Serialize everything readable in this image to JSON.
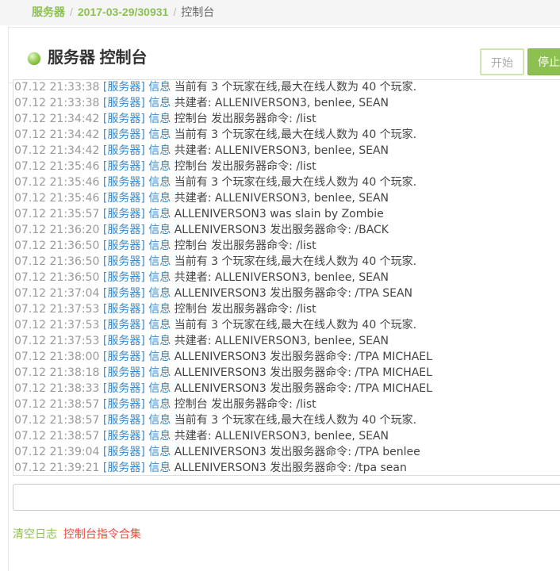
{
  "breadcrumb": {
    "items": [
      "服务器",
      "2017-03-29/30931"
    ],
    "current": "控制台",
    "separator": "/"
  },
  "header": {
    "title": "服务器 控制台",
    "status": "running",
    "start_label": "开始",
    "stop_label": "停止"
  },
  "console": {
    "lines": [
      {
        "ts": "07.12 21:33:38",
        "tag": "[服务器]",
        "level": "信息",
        "msg": "当前有 3 个玩家在线,最大在线人数为 40 个玩家."
      },
      {
        "ts": "07.12 21:33:38",
        "tag": "[服务器]",
        "level": "信息",
        "msg": "共建者: ALLENIVERSON3, benlee, SEAN"
      },
      {
        "ts": "07.12 21:34:42",
        "tag": "[服务器]",
        "level": "信息",
        "msg": "控制台 发出服务器命令: /list"
      },
      {
        "ts": "07.12 21:34:42",
        "tag": "[服务器]",
        "level": "信息",
        "msg": "当前有 3 个玩家在线,最大在线人数为 40 个玩家."
      },
      {
        "ts": "07.12 21:34:42",
        "tag": "[服务器]",
        "level": "信息",
        "msg": "共建者: ALLENIVERSON3, benlee, SEAN"
      },
      {
        "ts": "07.12 21:35:46",
        "tag": "[服务器]",
        "level": "信息",
        "msg": "控制台 发出服务器命令: /list"
      },
      {
        "ts": "07.12 21:35:46",
        "tag": "[服务器]",
        "level": "信息",
        "msg": "当前有 3 个玩家在线,最大在线人数为 40 个玩家."
      },
      {
        "ts": "07.12 21:35:46",
        "tag": "[服务器]",
        "level": "信息",
        "msg": "共建者: ALLENIVERSON3, benlee, SEAN"
      },
      {
        "ts": "07.12 21:35:57",
        "tag": "[服务器]",
        "level": "信息",
        "msg": "ALLENIVERSON3 was slain by Zombie"
      },
      {
        "ts": "07.12 21:36:20",
        "tag": "[服务器]",
        "level": "信息",
        "msg": "ALLENIVERSON3 发出服务器命令: /BACK"
      },
      {
        "ts": "07.12 21:36:50",
        "tag": "[服务器]",
        "level": "信息",
        "msg": "控制台 发出服务器命令: /list"
      },
      {
        "ts": "07.12 21:36:50",
        "tag": "[服务器]",
        "level": "信息",
        "msg": "当前有 3 个玩家在线,最大在线人数为 40 个玩家."
      },
      {
        "ts": "07.12 21:36:50",
        "tag": "[服务器]",
        "level": "信息",
        "msg": "共建者: ALLENIVERSON3, benlee, SEAN"
      },
      {
        "ts": "07.12 21:37:04",
        "tag": "[服务器]",
        "level": "信息",
        "msg": "ALLENIVERSON3 发出服务器命令: /TPA SEAN"
      },
      {
        "ts": "07.12 21:37:53",
        "tag": "[服务器]",
        "level": "信息",
        "msg": "控制台 发出服务器命令: /list"
      },
      {
        "ts": "07.12 21:37:53",
        "tag": "[服务器]",
        "level": "信息",
        "msg": "当前有 3 个玩家在线,最大在线人数为 40 个玩家."
      },
      {
        "ts": "07.12 21:37:53",
        "tag": "[服务器]",
        "level": "信息",
        "msg": "共建者: ALLENIVERSON3, benlee, SEAN"
      },
      {
        "ts": "07.12 21:38:00",
        "tag": "[服务器]",
        "level": "信息",
        "msg": "ALLENIVERSON3 发出服务器命令: /TPA MICHAEL"
      },
      {
        "ts": "07.12 21:38:18",
        "tag": "[服务器]",
        "level": "信息",
        "msg": "ALLENIVERSON3 发出服务器命令: /TPA MICHAEL"
      },
      {
        "ts": "07.12 21:38:33",
        "tag": "[服务器]",
        "level": "信息",
        "msg": "ALLENIVERSON3 发出服务器命令: /TPA MICHAEL"
      },
      {
        "ts": "07.12 21:38:57",
        "tag": "[服务器]",
        "level": "信息",
        "msg": "控制台 发出服务器命令: /list"
      },
      {
        "ts": "07.12 21:38:57",
        "tag": "[服务器]",
        "level": "信息",
        "msg": "当前有 3 个玩家在线,最大在线人数为 40 个玩家."
      },
      {
        "ts": "07.12 21:38:57",
        "tag": "[服务器]",
        "level": "信息",
        "msg": "共建者: ALLENIVERSON3, benlee, SEAN"
      },
      {
        "ts": "07.12 21:39:04",
        "tag": "[服务器]",
        "level": "信息",
        "msg": "ALLENIVERSON3 发出服务器命令: /TPA benlee"
      },
      {
        "ts": "07.12 21:39:21",
        "tag": "[服务器]",
        "level": "信息",
        "msg": "ALLENIVERSON3 发出服务器命令: /tpa sean"
      }
    ]
  },
  "command_input": {
    "value": "",
    "placeholder": ""
  },
  "footer": {
    "clear_log_label": "清空日志",
    "commands_label": "控制台指令合集"
  },
  "colors": {
    "accent": "#8cc152",
    "tag": "#3a87c8",
    "timestamp": "#999999",
    "danger_link": "#e74c3c"
  }
}
